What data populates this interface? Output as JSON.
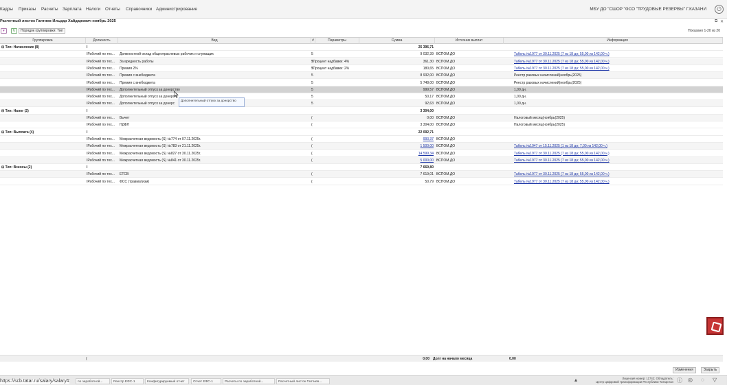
{
  "menu": {
    "items": [
      "Кадры",
      "Приказы",
      "Расчеты",
      "Зарплата",
      "Налоги",
      "Отчеты",
      "Справочники",
      "Администрирование"
    ],
    "org": "МБУ ДО \"СШОР \"ФСО \"ТРУДОВЫЕ РЕЗЕРВЫ\" Г.КАЗАНИ"
  },
  "doc": {
    "title": "Расчетный листок Гаптиев Ильдар Хайдарович ноябрь 2025",
    "ctrl_restore": "⧉",
    "ctrl_close": "✕"
  },
  "toolbar": {
    "grouping_label": "Порядок группировки: Тип",
    "shown": "Показано 1-20 из 20"
  },
  "columns": [
    "Группировка",
    "Должность",
    "Вид",
    "#",
    "Параметры",
    "Сумма",
    "Источник выплат",
    "Информация"
  ],
  "rows": [
    {
      "group": "⊟ Тип: Начисление (8)",
      "pos": "I",
      "vid": "",
      "n": "",
      "par": "",
      "sum": "25 396,71",
      "src": "",
      "info": "",
      "type": "grp"
    },
    {
      "group": "",
      "pos": "IРабочий по тех...",
      "vid": "Должностной оклад общеотраслевых рабочих и служащих",
      "n": "5",
      "par": "",
      "sum": "9 032,39",
      "src": "ВСПОМ.ДО",
      "info": "Табель №1977 от 30.11.2025 (7 из 18 дн; 55,00 из 142,00 ч.)",
      "link": true
    },
    {
      "group": "",
      "pos": "IРабочий по тех...",
      "vid": "За вредность работы",
      "n": "5",
      "par": "\\Процент надбавки: 4%",
      "sum": "361,30",
      "src": "ВСПОМ.ДО",
      "info": "Табель №1977 от 30.11.2025 (7 из 18 дн; 55,00 из 142,00 ч.)",
      "link": true
    },
    {
      "group": "",
      "pos": "IРабочий по тех...",
      "vid": "Премия 2%",
      "n": "5",
      "par": "\\Процент надбавки: 2%",
      "sum": "180,65",
      "src": "ВСПОМ.ДО",
      "info": "Табель №1977 от 30.11.2025 (7 из 18 дн; 55,00 из 142,00 ч.)",
      "link": true
    },
    {
      "group": "",
      "pos": "IРабочий по тех...",
      "vid": "Премия с внебюджета",
      "n": "5",
      "par": "",
      "sum": "8 932,00",
      "src": "ВСПОМ.ДО",
      "info": "Реестр разовых начислений(ноябрь(2025)"
    },
    {
      "group": "",
      "pos": "IРабочий по тех...",
      "vid": "Премия с внебюджета",
      "n": "5",
      "par": "",
      "sum": "5 748,00",
      "src": "ВСПОМ.ДО",
      "info": "Реестр разовых начислений(ноябрь(2025)"
    },
    {
      "group": "",
      "pos": "IРабочий по тех...",
      "vid": "Дополнительный отпуск за донорство",
      "n": "5",
      "par": "",
      "sum": "999,57",
      "src": "ВСПОМ.ДО",
      "info": "1,00 дн.",
      "type": "sel"
    },
    {
      "group": "",
      "pos": "IРабочий по тех...",
      "vid": "Дополнительный отпуск за донорс",
      "n": "5",
      "par": "",
      "sum": "50,17",
      "src": "ВСПОМ.ДО",
      "info": "1,00 дн."
    },
    {
      "group": "",
      "pos": "IРабочий по тех...",
      "vid": "Дополнительный отпуск за донорс",
      "n": "5",
      "par": "",
      "sum": "92,63",
      "src": "ВСПОМ.ДО",
      "info": "1,00 дн."
    },
    {
      "group": "⊟ Тип: Налог (2)",
      "pos": "I",
      "vid": "",
      "n": "",
      "par": "",
      "sum": "3 304,00",
      "src": "",
      "info": "",
      "type": "grp"
    },
    {
      "group": "",
      "pos": "IРабочий по тех...",
      "vid": "Вычет",
      "n": "(",
      "par": "",
      "sum": "0,00",
      "src": "ВСПОМ.ДО",
      "info": "Налоговый месяц(ноябрь(2025)"
    },
    {
      "group": "",
      "pos": "IРабочий по тех...",
      "vid": "НДФЛ",
      "n": "(",
      "par": "",
      "sum": "3 304,00",
      "src": "ВСПОМ.ДО",
      "info": "Налоговый месяц(ноябрь(2025)"
    },
    {
      "group": "⊟ Тип: Выплата (4)",
      "pos": "I",
      "vid": "",
      "n": "",
      "par": "",
      "sum": "22 092,71",
      "src": "",
      "info": "",
      "type": "grp"
    },
    {
      "group": "",
      "pos": "IРабочий по тех...",
      "vid": "Межрасчетная ведомость (S) №774 от 07.11.2025г.",
      "n": "(",
      "par": "",
      "sum": "993,37",
      "sumlink": true,
      "src": "ВСПОМ.ДО",
      "info": ""
    },
    {
      "group": "",
      "pos": "IРабочий по тех...",
      "vid": "Межрасчетная ведомость (S) №783 от 21.11.2025г.",
      "n": "(",
      "par": "",
      "sum": "1 500,00",
      "sumlink": true,
      "src": "ВСПОМ.ДО",
      "info": "Табель №1947 от 15.11.2025 (1 из 18 дн; 7,00 из 142,00 ч.)",
      "link": true
    },
    {
      "group": "",
      "pos": "IРабочий по тех...",
      "vid": "Межрасчетная ведомость (S) №827 от 30.11.2025г.",
      "n": "(",
      "par": "",
      "sum": "14 599,34",
      "sumlink": true,
      "src": "ВСПОМ.ДО",
      "info": "Табель №1977 от 30.11.2025 (7 из 18 дн; 55,00 из 142,00 ч.)",
      "link": true
    },
    {
      "group": "",
      "pos": "IРабочий по тех...",
      "vid": "Межрасчетная ведомость (S) №841 от 30.11.2025г.",
      "n": "(",
      "par": "",
      "sum": "5 000,00",
      "sumlink": true,
      "src": "ВСПОМ.ДО",
      "info": "Табель №1977 от 30.11.2025 (7 из 18 дн; 55,00 из 142,00 ч.)",
      "link": true
    },
    {
      "group": "⊟ Тип: Взносы (2)",
      "pos": "I",
      "vid": "",
      "n": "",
      "par": "",
      "sum": "7 669,80",
      "src": "",
      "info": "",
      "type": "grp"
    },
    {
      "group": "",
      "pos": "IРабочий по тех...",
      "vid": "ЕТСВ",
      "n": "(",
      "par": "",
      "sum": "7 619,01",
      "src": "ВСПОМ.ДО",
      "info": "Табель №1977 от 30.11.2025 (7 из 18 дн; 55,00 из 142,00 ч.)",
      "link": true
    },
    {
      "group": "",
      "pos": "IРабочий по тех...",
      "vid": "ФСС (травматизм)",
      "n": "(",
      "par": "",
      "sum": "50,79",
      "src": "ВСПОМ.ДО",
      "info": "Табель №1977 от 30.11.2025 (7 из 18 дн; 55,00 из 142,00 ч.)",
      "link": true
    }
  ],
  "tooltip": "Дополнительный отпуск за донорство",
  "footer": {
    "pos": "(",
    "sum": "0,00",
    "debt_label": "Долг на начало месяца",
    "debt_value": "0.00"
  },
  "buttons": {
    "changes": "Изменения",
    "close": "Закрыть"
  },
  "taskbar": {
    "url": "https://scb.tatar.ru/salary/salary#",
    "tasks": [
      "по заработной...",
      "Реестр ЕФС-1",
      "Конфигурируемый отчет",
      "Отчет ЕФС-1",
      "Расчеты по заработной...",
      "Расчетный листок Гаптиев..."
    ],
    "license_line1": "Лицензия номер: 11742; Обладатель:",
    "license_line2": "Центр цифровой трансформации Республики Татарстан"
  }
}
